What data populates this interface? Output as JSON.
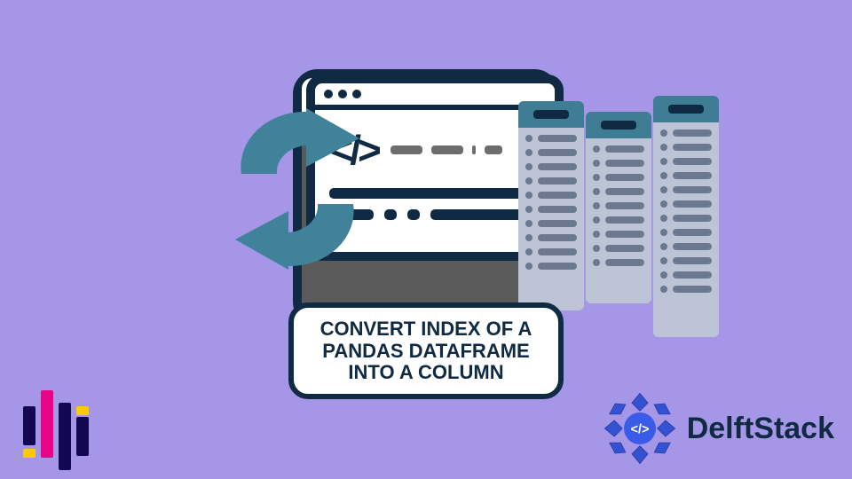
{
  "caption": {
    "line1": "CONVERT INDEX OF A",
    "line2": "PANDAS DATAFRAME",
    "line3": "INTO A COLUMN"
  },
  "brand": {
    "name": "DelftStack"
  },
  "icons": {
    "code_tag": "</>",
    "swap": "swap-arrows-icon",
    "columns": "data-columns-icon",
    "rosette": "delftstack-rosette-icon",
    "pandas": "pandas-logo-icon"
  },
  "colors": {
    "background": "#a696e8",
    "ink": "#0f2a42",
    "teal": "#3e7d94",
    "swirl": "#40829a"
  }
}
